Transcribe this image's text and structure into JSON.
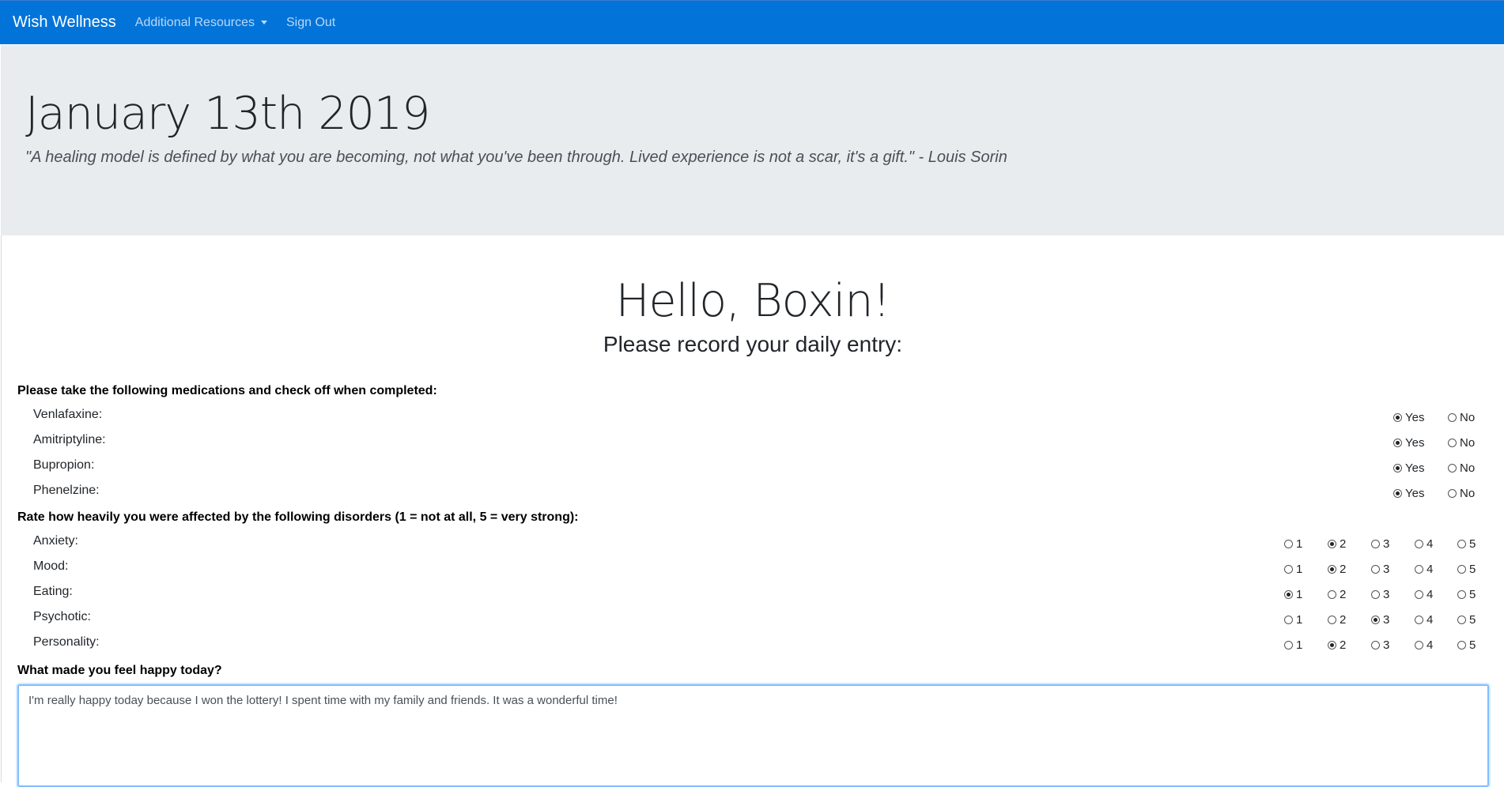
{
  "navbar": {
    "brand": "Wish Wellness",
    "resources": "Additional Resources",
    "signout": "Sign Out"
  },
  "header": {
    "date": "January 13th 2019",
    "quote": "\"A healing model is defined by what you are becoming, not what you've been through. Lived experience is not a scar, it's a gift.\" - Louis Sorin"
  },
  "main": {
    "greeting": "Hello, Boxin!",
    "subtitle": "Please record your daily entry:",
    "meds_title": "Please take the following medications and check off when completed:",
    "meds": [
      {
        "label": "Venlafaxine:",
        "yes": "Yes",
        "no": "No",
        "selected": "Yes"
      },
      {
        "label": "Amitriptyline:",
        "yes": "Yes",
        "no": "No",
        "selected": "Yes"
      },
      {
        "label": "Bupropion:",
        "yes": "Yes",
        "no": "No",
        "selected": "Yes"
      },
      {
        "label": "Phenelzine:",
        "yes": "Yes",
        "no": "No",
        "selected": "Yes"
      }
    ],
    "ratings_title": "Rate how heavily you were affected by the following disorders (1 = not at all, 5 = very strong):",
    "rating_options": [
      "1",
      "2",
      "3",
      "4",
      "5"
    ],
    "ratings": [
      {
        "label": "Anxiety:",
        "selected": 2
      },
      {
        "label": "Mood:",
        "selected": 2
      },
      {
        "label": "Eating:",
        "selected": 1
      },
      {
        "label": "Psychotic:",
        "selected": 3
      },
      {
        "label": "Personality:",
        "selected": 2
      }
    ],
    "happy_title": "What made you feel happy today?",
    "happy_value": "I'm really happy today because I won the lottery! I spent time with my family and friends. It was a wonderful time!"
  },
  "colors": {
    "navbar": "#0274d9",
    "jumbotron": "#e9ecef",
    "focus_border": "#80bdff"
  }
}
